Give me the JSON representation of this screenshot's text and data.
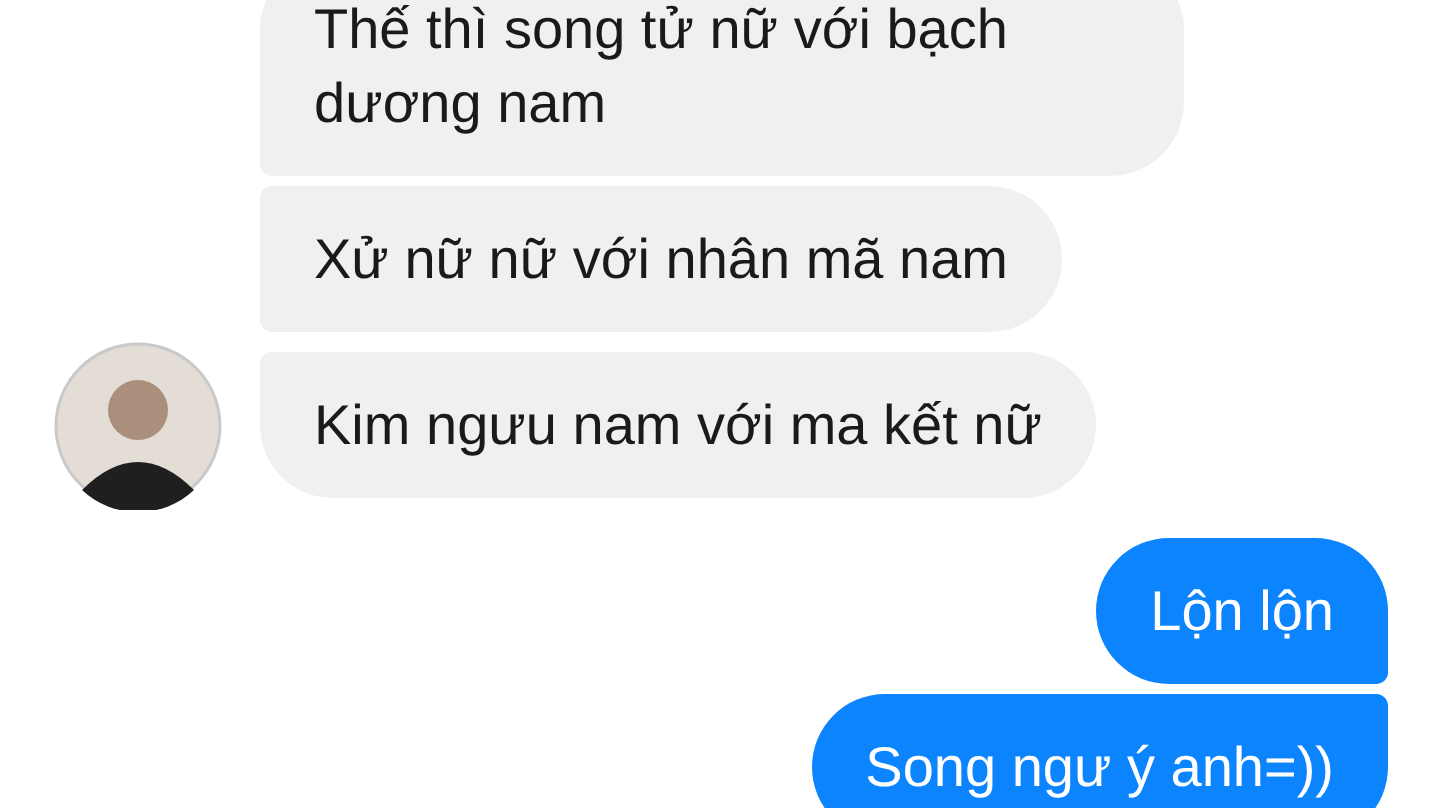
{
  "messages": [
    {
      "kind": "incoming",
      "text": "Thế thì song tử nữ với bạch dương nam",
      "avatar": false
    },
    {
      "kind": "incoming",
      "text": "Xử nữ nữ với nhân mã nam",
      "avatar": false
    },
    {
      "kind": "incoming",
      "text": "Kim ngưu nam với ma kết nữ",
      "avatar": true
    },
    {
      "kind": "outgoing",
      "text": "Lộn lộn",
      "avatar": false
    },
    {
      "kind": "outgoing",
      "text": "Song ngư ý anh=))",
      "avatar": false
    }
  ]
}
